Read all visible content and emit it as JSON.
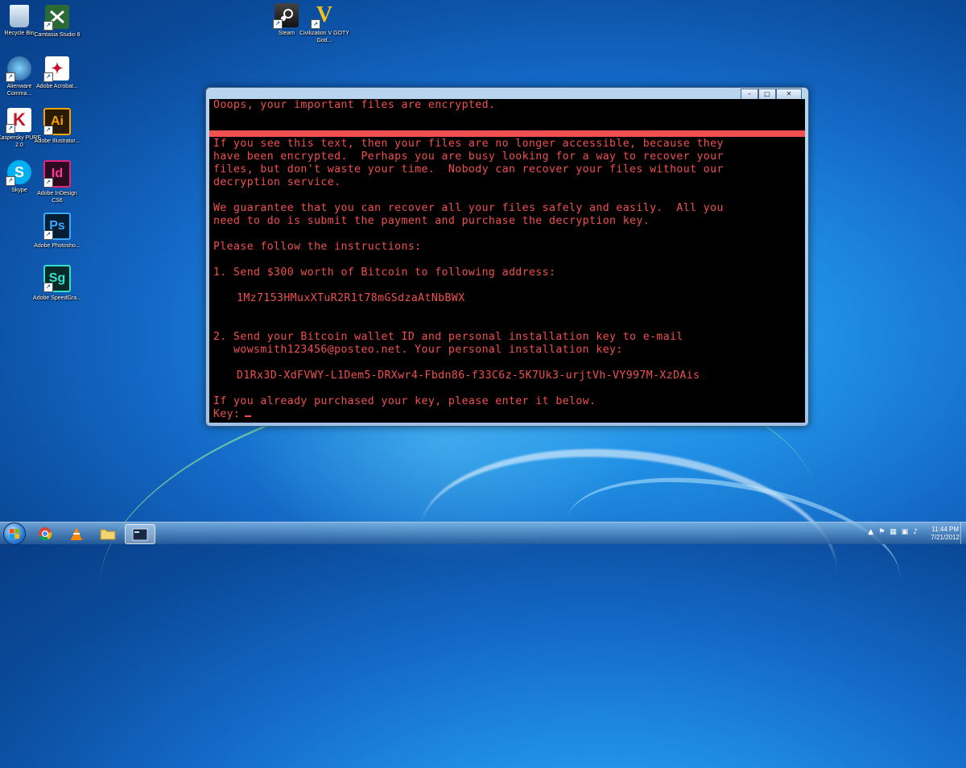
{
  "desktop": {
    "icons": [
      {
        "label": "Recycle Bin",
        "icon": "recycle-bin-icon"
      },
      {
        "label": "Camtasia Studio 8",
        "icon": "camtasia-icon"
      },
      {
        "label": "Alienware Comma...",
        "icon": "alienware-icon"
      },
      {
        "label": "Adobe Acrobat...",
        "icon": "acrobat-icon"
      },
      {
        "label": "Kaspersky PURE 2.0",
        "icon": "kaspersky-icon",
        "glyph": "K"
      },
      {
        "label": "Adobe Illustrator...",
        "icon": "illustrator-icon",
        "glyph": "Ai"
      },
      {
        "label": "Skype",
        "icon": "skype-icon",
        "glyph": "S"
      },
      {
        "label": "Adobe InDesign CS6",
        "icon": "indesign-icon",
        "glyph": "Id"
      },
      {
        "label": "Adobe Photosho...",
        "icon": "photoshop-icon",
        "glyph": "Ps"
      },
      {
        "label": "Adobe SpeedGra...",
        "icon": "speedgrade-icon",
        "glyph": "Sg"
      },
      {
        "label": "Steam",
        "icon": "steam-icon"
      },
      {
        "label": "Civilization V GOTY God...",
        "icon": "civilization-icon",
        "glyph": "V"
      }
    ]
  },
  "window": {
    "controls": {
      "minimize": "–",
      "maximize": "□",
      "close": "✕"
    }
  },
  "console": {
    "header": "Ooops, your important files are encrypted.",
    "para1": [
      "If you see this text, then your files are no longer accessible, because they",
      "have been encrypted.  Perhaps you are busy looking for a way to recover your",
      "files, but don't waste your time.  Nobody can recover your files without our",
      "decryption service."
    ],
    "para2": [
      "We guarantee that you can recover all your files safely and easily.  All you",
      "need to do is submit the payment and purchase the decryption key."
    ],
    "instructions": "Please follow the instructions:",
    "step1": "1. Send $300 worth of Bitcoin to following address:",
    "address": "1Mz7153HMuxXTuR2R1t78mGSdzaAtNbBWX",
    "step2": [
      "2. Send your Bitcoin wallet ID and personal installation key to e-mail",
      "   wowsmith123456@posteo.net. Your personal installation key:"
    ],
    "key": "D1Rx3D-XdFVWY-L1Dem5-DRXwr4-Fbdn86-f33C6z-5K7Uk3-urjtVh-VY997M-XzDAis",
    "purchased": "If you already purchased your key, please enter it below.",
    "prompt": "Key:"
  },
  "taskbar": {
    "apps": [
      "chrome-icon",
      "vlc-icon",
      "explorer-icon",
      "console-app-icon"
    ],
    "clock": {
      "time": "11:44 PM",
      "date": "7/21/2012"
    }
  },
  "colors": {
    "console_text": "#f05050",
    "console_bg": "#000000"
  }
}
